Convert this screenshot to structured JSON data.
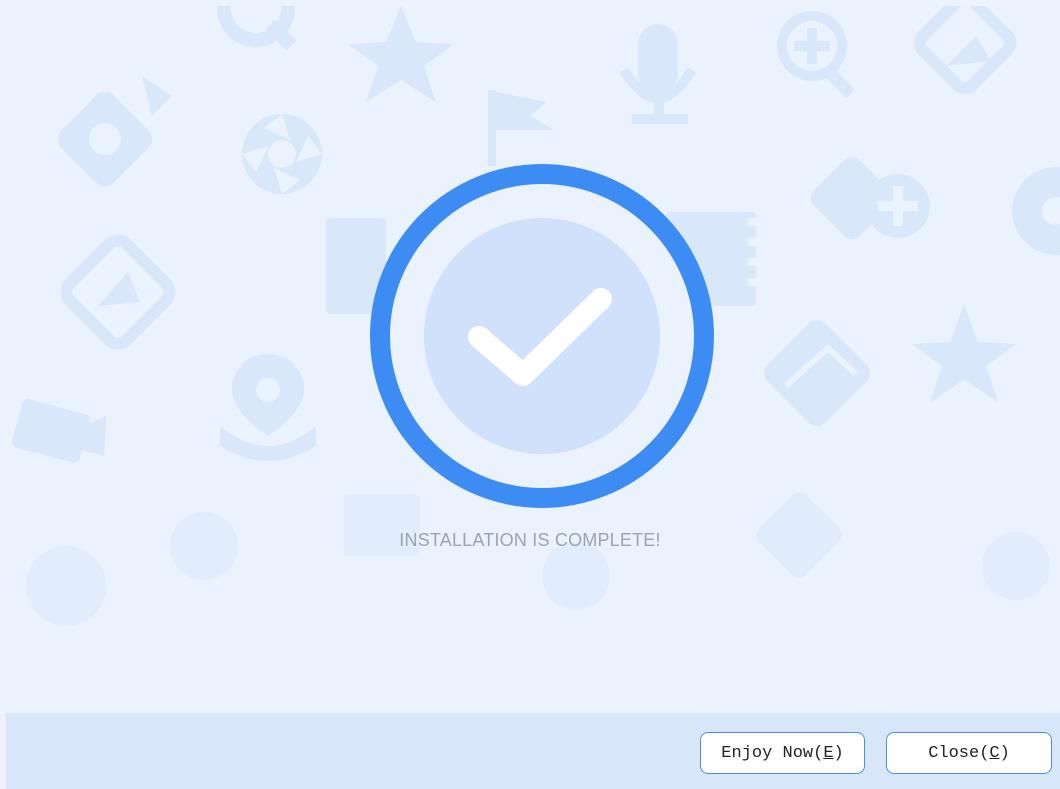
{
  "status": {
    "message": "INSTALLATION IS COMPLETE!",
    "icon": "checkmark-icon"
  },
  "footer": {
    "enjoy_button": {
      "label": "Enjoy Now",
      "mnemonic": "E"
    },
    "close_button": {
      "label": "Close",
      "mnemonic": "C"
    }
  },
  "colors": {
    "accent": "#3c8cf4",
    "background": "#eaf2fd",
    "footer_bg": "#d8e6fa",
    "pattern_icon": "#d6e6fb",
    "status_text": "#9aa3ae"
  },
  "background_icons": [
    "camera-icon",
    "star-icon",
    "microphone-icon",
    "zoom-in-icon",
    "image-icon",
    "aperture-icon",
    "flag-icon",
    "film-icon",
    "location-pin-icon",
    "video-camera-icon"
  ]
}
